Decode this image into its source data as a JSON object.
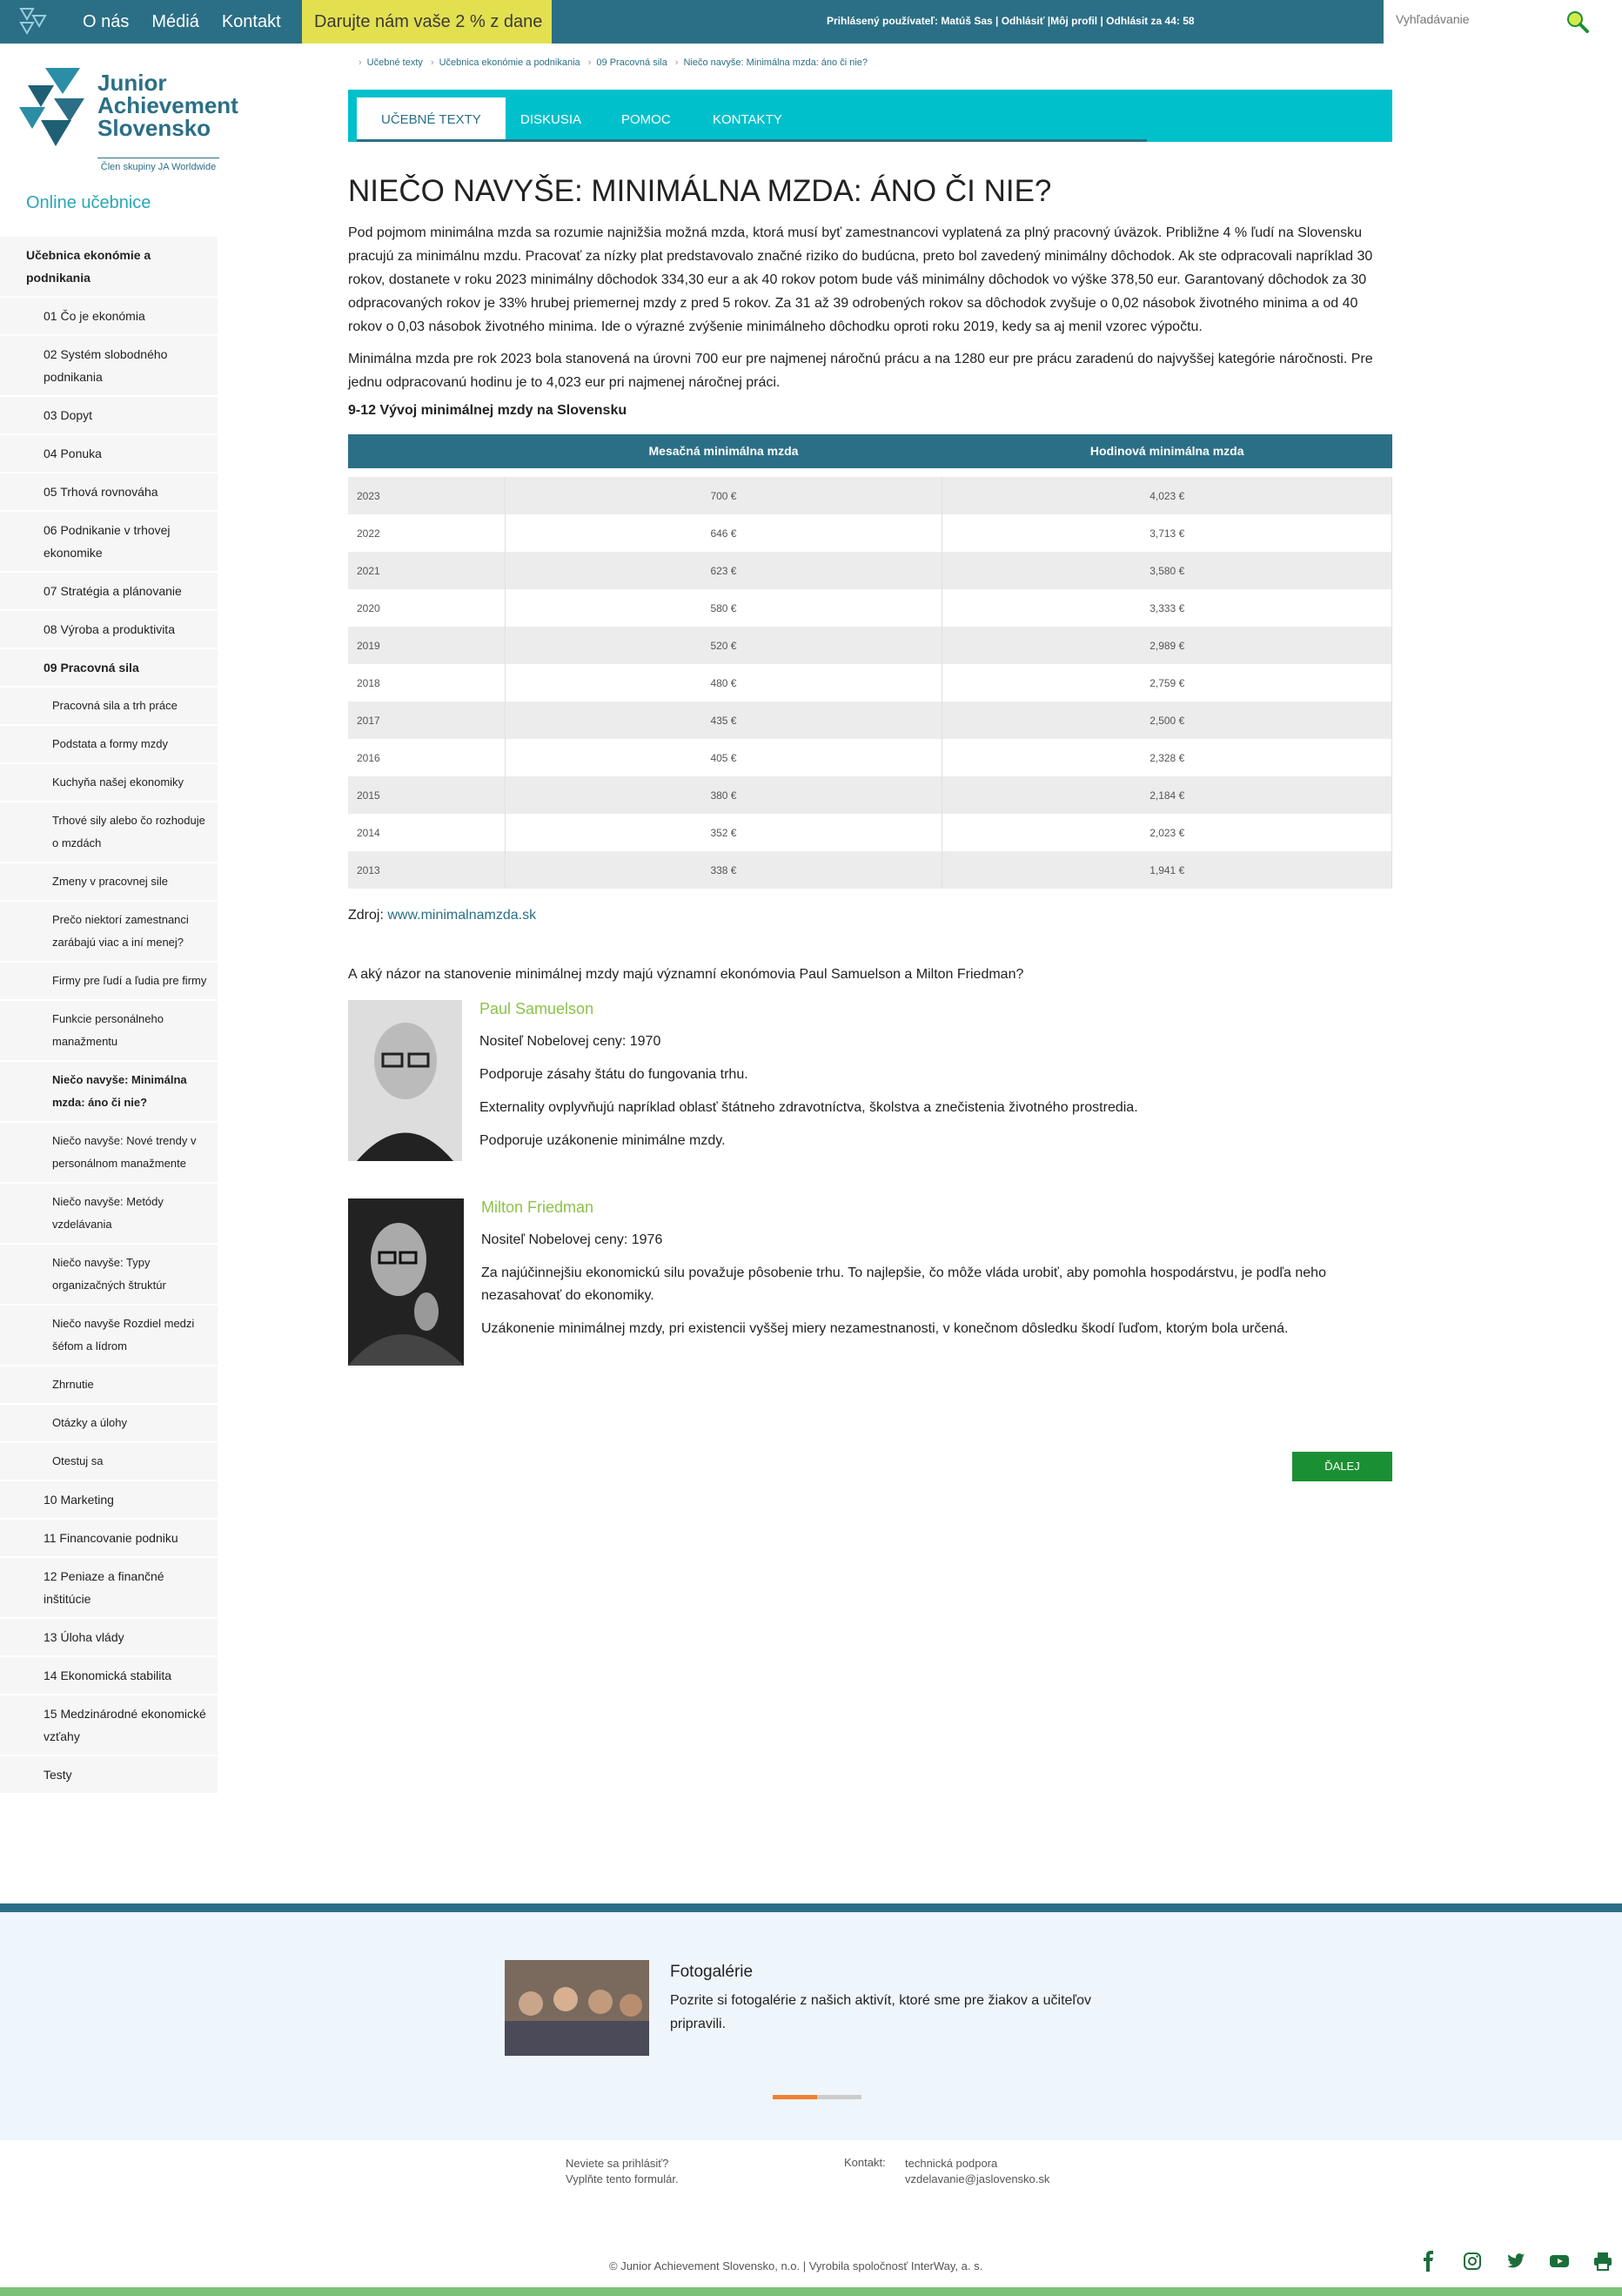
{
  "topbar": {
    "nav": [
      "O nás",
      "Médiá",
      "Kontakt"
    ],
    "donate": "Darujte nám vaše 2 % z dane",
    "user_line": "Prihlásený používateľ: Matúš Sas | Odhlásiť |Môj profil | Odhlásit za 44: 58",
    "search_placeholder": "Vyhľadávanie"
  },
  "logo": {
    "line1": "Junior",
    "line2": "Achievement",
    "line3": "Slovensko",
    "sub": "Člen skupiny JA Worldwide"
  },
  "sidebar": {
    "title": "Online učebnice",
    "items": [
      {
        "label": "Učebnica ekonómie a podnikania",
        "level": 0
      },
      {
        "label": "01 Čo je ekonómia",
        "level": 1
      },
      {
        "label": "02 Systém slobodného podnikania",
        "level": 1
      },
      {
        "label": "03 Dopyt",
        "level": 1
      },
      {
        "label": "04 Ponuka",
        "level": 1
      },
      {
        "label": "05 Trhová rovnováha",
        "level": 1
      },
      {
        "label": "06 Podnikanie v trhovej ekonomike",
        "level": 1
      },
      {
        "label": "07 Stratégia a plánovanie",
        "level": 1
      },
      {
        "label": "08 Výroba a produktivita",
        "level": 1
      },
      {
        "label": "09 Pracovná sila",
        "level": 1,
        "bold": true
      },
      {
        "label": "Pracovná sila a trh práce",
        "level": 2
      },
      {
        "label": "Podstata a formy mzdy",
        "level": 2
      },
      {
        "label": "Kuchyňa našej ekonomiky",
        "level": 2
      },
      {
        "label": "Trhové sily alebo čo rozhoduje o mzdách",
        "level": 2
      },
      {
        "label": "Zmeny v pracovnej sile",
        "level": 2
      },
      {
        "label": "Prečo niektorí zamestnanci zarábajú viac a iní menej?",
        "level": 2
      },
      {
        "label": "Firmy pre ľudí a ľudia pre firmy",
        "level": 2
      },
      {
        "label": "Funkcie personálneho manažmentu",
        "level": 2
      },
      {
        "label": "Niečo navyše: Minimálna mzda: áno či nie?",
        "level": 2,
        "bold": true
      },
      {
        "label": "Niečo navyše: Nové trendy v personálnom manažmente",
        "level": 2
      },
      {
        "label": "Niečo navyše: Metódy vzdelávania",
        "level": 2
      },
      {
        "label": "Niečo navyše: Typy organizačných štruktúr",
        "level": 2
      },
      {
        "label": "Niečo navyše Rozdiel medzi šéfom a lídrom",
        "level": 2
      },
      {
        "label": "Zhrnutie",
        "level": 2
      },
      {
        "label": "Otázky a úlohy",
        "level": 2
      },
      {
        "label": "Otestuj sa",
        "level": 2
      },
      {
        "label": "10 Marketing",
        "level": 1
      },
      {
        "label": "11 Financovanie podniku",
        "level": 1
      },
      {
        "label": "12 Peniaze a finančné inštitúcie",
        "level": 1
      },
      {
        "label": "13 Úloha vlády",
        "level": 1
      },
      {
        "label": "14 Ekonomická stabilita",
        "level": 1
      },
      {
        "label": "15 Medzinárodné ekonomické vzťahy",
        "level": 1
      },
      {
        "label": "Testy",
        "level": 1
      }
    ]
  },
  "breadcrumb": [
    "Učebné texty",
    "Učebnica ekonómie a podnikania",
    "09 Pracovná sila",
    "Niečo navyše: Minimálna mzda: áno či nie?"
  ],
  "tabs": [
    "UČEBNÉ TEXTY",
    "DISKUSIA",
    "POMOC",
    "KONTAKTY"
  ],
  "content": {
    "title": "NIEČO NAVYŠE: MINIMÁLNA MZDA: ÁNO ČI NIE?",
    "p1": "Pod pojmom minimálna mzda sa rozumie najnižšia možná mzda, ktorá musí byť zamestnancovi vyplatená za plný pracovný úväzok. Približne 4 % ľudí na Slovensku pracujú za minimálnu mzdu. Pracovať za nízky plat predstavovalo značné riziko do budúcna, preto bol zavedený minimálny dôchodok. Ak ste odpracovali napríklad 30 rokov, dostanete v roku 2023 minimálny dôchodok 334,30 eur a ak 40 rokov potom bude váš minimálny dôchodok vo výške 378,50 eur. Garantovaný dôchodok za 30 odpracovaných rokov je 33% hrubej priemernej mzdy z pred 5 rokov. Za 31 až 39 odrobených rokov sa dôchodok zvyšuje o 0,02 násobok životného minima a od 40 rokov o 0,03 násobok životného minima. Ide o výrazné zvýšenie minimálneho dôchodku oproti roku 2019, kedy sa aj menil vzorec výpočtu.",
    "p2": "Minimálna mzda pre rok 2023 bola stanovená na úrovni 700 eur pre najmenej náročnú prácu a na 1280 eur pre prácu zaradenú do najvyššej kategórie náročnosti. Pre jednu odpracovanú hodinu je to 4,023 eur pri najmenej náročnej práci.",
    "table_caption": "9-12 Vývoj minimálnej mzdy na Slovensku",
    "table_headers": [
      "Mesačná minimálna mzda",
      "Hodinová minimálna mzda"
    ],
    "table_rows": [
      [
        "2023",
        "700 €",
        "4,023 €"
      ],
      [
        "2022",
        "646 €",
        "3,713 €"
      ],
      [
        "2021",
        "623 €",
        "3,580 €"
      ],
      [
        "2020",
        "580 €",
        "3,333 €"
      ],
      [
        "2019",
        "520 €",
        "2,989 €"
      ],
      [
        "2018",
        "480 €",
        "2,759 €"
      ],
      [
        "2017",
        "435 €",
        "2,500 €"
      ],
      [
        "2016",
        "405 €",
        "2,328 €"
      ],
      [
        "2015",
        "380 €",
        "2,184 €"
      ],
      [
        "2014",
        "352 €",
        "2,023 €"
      ],
      [
        "2013",
        "338 €",
        "1,941 €"
      ]
    ],
    "source_label": "Zdroj:",
    "source_link": "www.minimalnamzda.sk",
    "question": "A aký názor na stanovenie minimálnej mzdy majú významní ekonómovia Paul Samuelson a Milton Friedman?",
    "persons": [
      {
        "name": "Paul Samuelson",
        "facts": [
          "Nositeľ Nobelovej ceny: 1970",
          "Podporuje zásahy štátu do fungovania trhu.",
          "Externality ovplyvňujú napríklad oblasť štátneho zdravotníctva, školstva a znečistenia životného prostredia.",
          "Podporuje uzákonenie minimálne mzdy."
        ]
      },
      {
        "name": "Milton Friedman",
        "facts": [
          "Nositeľ Nobelovej ceny: 1976",
          "Za najúčinnejšiu ekonomickú silu považuje pôsobenie trhu. To najlepšie, čo môže vláda urobiť, aby pomohla hospodárstvu, je podľa neho nezasahovať do ekonomiky.",
          "Uzákonenie minimálnej mzdy, pri existencii vyššej miery nezamestnanosti, v konečnom dôsledku škodí ľuďom, ktorým bola určená."
        ]
      }
    ],
    "next_button": "ĎALEJ"
  },
  "footer": {
    "gallery_title": "Fotogalérie",
    "gallery_text": "Pozrite si fotogalérie z našich aktivít, ktoré sme pre žiakov a učiteľov pripravili.",
    "login_line1": "Neviete sa prihlásiť?",
    "login_line2": "Vyplňte tento formulár.",
    "contact_label": "Kontakt:",
    "contact_line1": "technická podpora",
    "contact_line2": "vzdelavanie@jaslovensko.sk",
    "copyright": "© Junior Achievement Slovensko, n.o. | Vyrobila spoločnosť InterWay, a. s."
  },
  "colors": {
    "primary": "#2b6f86",
    "accent": "#00c0cc",
    "donate": "#e3e04f",
    "green": "#1b8f34",
    "name": "#8bc34a"
  }
}
